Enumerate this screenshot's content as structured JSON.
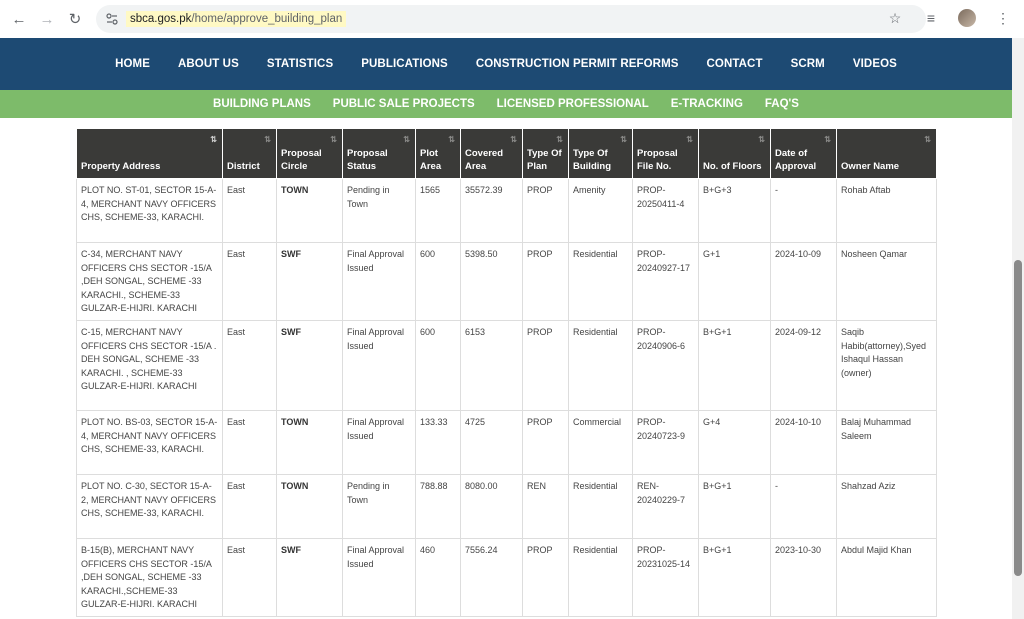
{
  "browser": {
    "url_domain": "sbca.gos.pk",
    "url_path": "/home/approve_building_plan"
  },
  "main_nav": [
    "HOME",
    "ABOUT US",
    "STATISTICS",
    "PUBLICATIONS",
    "CONSTRUCTION PERMIT REFORMS",
    "CONTACT",
    "SCRM",
    "VIDEOS"
  ],
  "sub_nav": [
    "BUILDING PLANS",
    "PUBLIC SALE PROJECTS",
    "LICENSED PROFESSIONAL",
    "E-TRACKING",
    "FAQ'S"
  ],
  "table": {
    "headers": [
      "Property Address",
      "District",
      "Proposal Circle",
      "Proposal Status",
      "Plot Area",
      "Covered Area",
      "Type Of Plan",
      "Type Of Building",
      "Proposal File No.",
      "No. of Floors",
      "Date of Approval",
      "Owner Name"
    ],
    "rows": [
      [
        "PLOT NO. ST-01, SECTOR 15-A-4, MERCHANT NAVY OFFICERS CHS, SCHEME-33, KARACHI.",
        "East",
        "TOWN",
        "Pending in Town",
        "1565",
        "35572.39",
        "PROP",
        "Amenity",
        "PROP-20250411-4",
        "B+G+3",
        "-",
        "Rohab Aftab"
      ],
      [
        "C-34, MERCHANT NAVY OFFICERS CHS SECTOR -15/A ,DEH SONGAL, SCHEME -33 KARACHI., SCHEME-33 GULZAR-E-HIJRI. KARACHI",
        "East",
        "SWF",
        "Final Approval Issued",
        "600",
        "5398.50",
        "PROP",
        "Residential",
        "PROP-20240927-17",
        "G+1",
        "2024-10-09",
        "Nosheen Qamar"
      ],
      [
        "C-15, MERCHANT NAVY OFFICERS CHS SECTOR -15/A . DEH SONGAL, SCHEME -33 KARACHI. , SCHEME-33 GULZAR-E-HIJRI. KARACHI",
        "East",
        "SWF",
        "Final Approval Issued",
        "600",
        "6153",
        "PROP",
        "Residential",
        "PROP-20240906-6",
        "B+G+1",
        "2024-09-12",
        "Saqib Habib(attorney),Syed Ishaqul Hassan (owner)"
      ],
      [
        "PLOT NO. BS-03, SECTOR 15-A-4, MERCHANT NAVY OFFICERS CHS, SCHEME-33, KARACHI.",
        "East",
        "TOWN",
        "Final Approval Issued",
        "133.33",
        "4725",
        "PROP",
        "Commercial",
        "PROP-20240723-9",
        "G+4",
        "2024-10-10",
        "Balaj Muhammad Saleem"
      ],
      [
        "PLOT NO. C-30, SECTOR 15-A-2, MERCHANT NAVY OFFICERS CHS, SCHEME-33, KARACHI.",
        "East",
        "TOWN",
        "Pending in Town",
        "788.88",
        "8080.00",
        "REN",
        "Residential",
        "REN-20240229-7",
        "B+G+1",
        "-",
        "Shahzad Aziz"
      ],
      [
        "B-15(B), MERCHANT NAVY OFFICERS CHS SECTOR -15/A ,DEH SONGAL, SCHEME -33 KARACHI.,SCHEME-33 GULZAR-E-HIJRI. KARACHI",
        "East",
        "SWF",
        "Final Approval Issued",
        "460",
        "7556.24",
        "PROP",
        "Residential",
        "PROP-20231025-14",
        "B+G+1",
        "2023-10-30",
        "Abdul Majid Khan"
      ]
    ]
  }
}
